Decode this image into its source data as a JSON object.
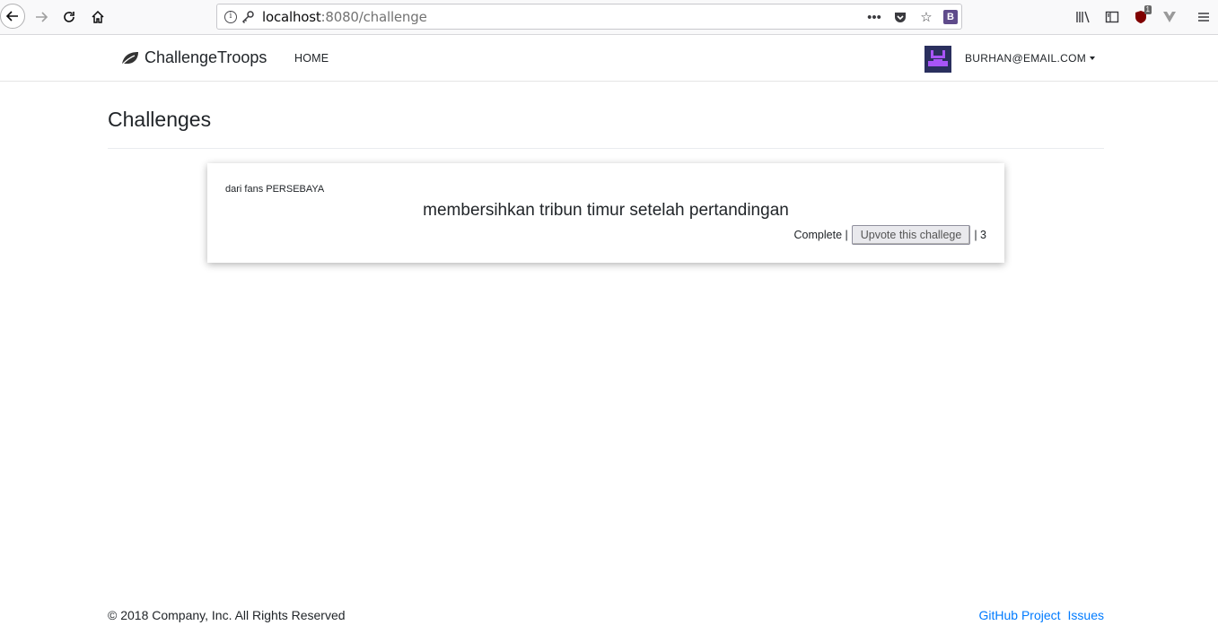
{
  "browser": {
    "url_host": "localhost",
    "url_path": ":8080/challenge",
    "ublock_count": "1",
    "extension_badge": "B"
  },
  "navbar": {
    "brand": "ChallengeTroops",
    "home": "HOME",
    "user": "BURHAN@EMAIL.COM",
    "avatar_color": "#2a2f5e",
    "avatar_accent": "#a855f7"
  },
  "main": {
    "title": "Challenges",
    "challenges": [
      {
        "from": "dari fans PERSEBAYA",
        "title": "membersihkan tribun timur setelah pertandingan",
        "status": "Complete |",
        "upvote_label": "Upvote this challege",
        "votes": "| 3"
      }
    ]
  },
  "footer": {
    "copyright": "© 2018 Company, Inc. All Rights Reserved",
    "links": [
      "GitHub Project",
      "Issues"
    ],
    "link_color": "#007bff"
  }
}
